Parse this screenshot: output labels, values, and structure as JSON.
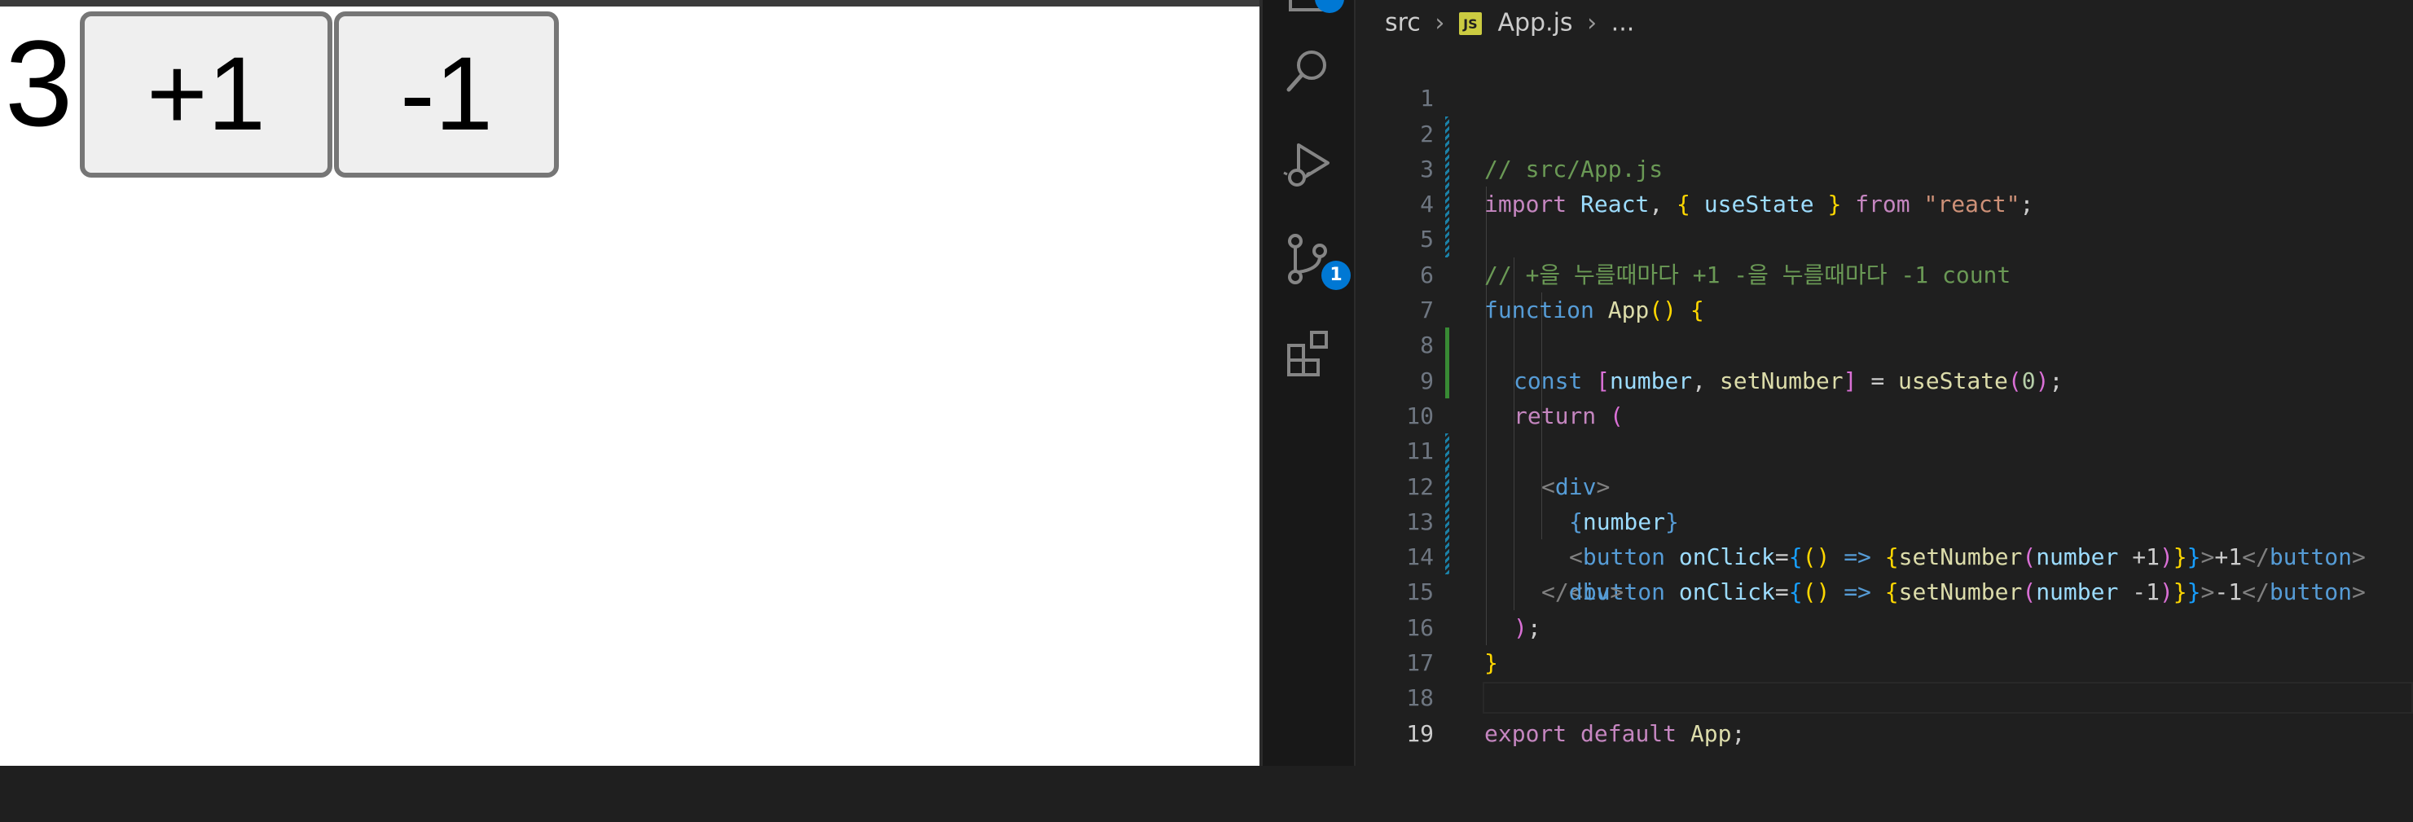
{
  "preview": {
    "counter_value": "3",
    "plus_button_label": "+1",
    "minus_button_label": "-1"
  },
  "activity_bar": {
    "source_control_badge": "1"
  },
  "breadcrumb": {
    "folder": "src",
    "file": "App.js",
    "file_icon": "JS",
    "more": "..."
  },
  "editor": {
    "active_line": 19,
    "line_numbers": [
      "1",
      "2",
      "3",
      "4",
      "5",
      "6",
      "7",
      "8",
      "9",
      "10",
      "11",
      "12",
      "13",
      "14",
      "15",
      "16",
      "17",
      "18",
      "19"
    ]
  },
  "code": {
    "l1": "// src/App.js",
    "l2_import": "import",
    "l2_react": "React",
    "l2_usestate": "useState",
    "l2_from": "from",
    "l2_module": "\"react\"",
    "l4": "// +을 누를때마다 +1 -을 누를때마다 -1 count",
    "l6_function": "function",
    "l6_name": "App",
    "l7_const": "const",
    "l7_number": "number",
    "l7_setter": "setNumber",
    "l7_usestate": "useState",
    "l7_init": "0",
    "l9_return": "return",
    "l10_tag": "div",
    "l11_expr": "number",
    "l12_tag": "button",
    "l12_attr": "onClick",
    "l12_call": "setNumber",
    "l12_arg": "number",
    "l12_op": "+1",
    "l12_text": "+1",
    "l13_tag": "button",
    "l13_attr": "onClick",
    "l13_call": "setNumber",
    "l13_arg": "number",
    "l13_op": "-1",
    "l13_text": "-1",
    "l14_tag": "div",
    "l18_export": "export",
    "l18_default": "default",
    "l18_name": "App"
  },
  "colors": {
    "editor_bg": "#1f1f1f",
    "activity_bg": "#181818",
    "badge": "#0078d4",
    "comment": "#6a9955",
    "keyword": "#c586c0",
    "string": "#ce9178"
  }
}
